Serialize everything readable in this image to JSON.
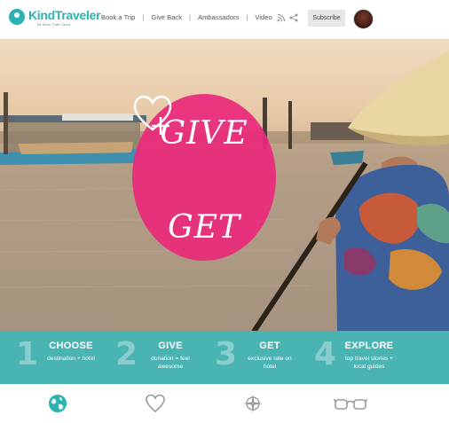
{
  "header": {
    "logo": {
      "name": "KindTraveler",
      "tagline": "Be More Than Cared"
    },
    "nav": [
      {
        "label": "Book a Trip"
      },
      {
        "label": "Give Back"
      },
      {
        "label": "Ambassadors"
      },
      {
        "label": "Video"
      }
    ],
    "nav_separator": "|",
    "subscribe_label": "Subscribe"
  },
  "hero": {
    "badge": {
      "top_text": "GIVE",
      "bottom_text": "GET"
    }
  },
  "steps": [
    {
      "number": "1",
      "title": "CHOOSE",
      "desc_line1": "destination + hotel",
      "desc_line2": ""
    },
    {
      "number": "2",
      "title": "GIVE",
      "desc_line1": "donation = feel",
      "desc_line2": "awesome"
    },
    {
      "number": "3",
      "title": "GET",
      "desc_line1": "exclusive rate on",
      "desc_line2": "hotel"
    },
    {
      "number": "4",
      "title": "EXPLORE",
      "desc_line1": "top travel stories +",
      "desc_line2": "local guides"
    }
  ],
  "bottom_icons": [
    "globe-icon",
    "heart-icon",
    "compass-icon",
    "glasses-icon"
  ],
  "colors": {
    "brand_teal": "#2bb3b1",
    "badge_pink": "#ea2a7b",
    "steps_band": "#40b8b8"
  }
}
